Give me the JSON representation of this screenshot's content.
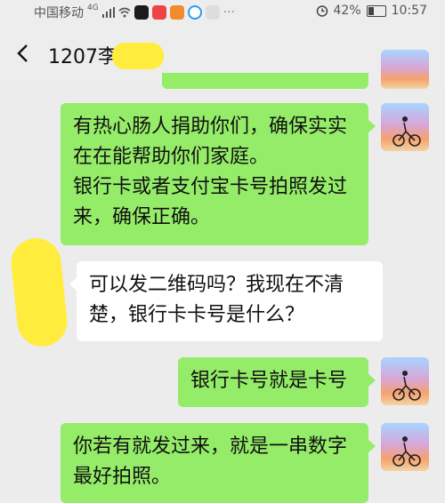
{
  "status_bar": {
    "carrier": "中国移动",
    "network": "4G",
    "battery_percent": "42%",
    "battery_level": 0.42,
    "time": "10:57"
  },
  "header": {
    "title": "1207李",
    "back_icon": "chevron-left-icon",
    "more_icon": "more-dots-icon"
  },
  "messages": [
    {
      "side": "right",
      "text_lines": [
        "有热心肠人捐助你们，确保实实",
        "在在能帮助你们家庭。",
        "银行卡或者支付宝卡号拍照发过",
        "来，确保正确。"
      ]
    },
    {
      "side": "left",
      "text_lines": [
        "可以发二维码吗？我现在不清",
        "楚，银行卡卡号是什么？"
      ]
    },
    {
      "side": "right",
      "text_lines": [
        "银行卡号就是卡号"
      ]
    },
    {
      "side": "right",
      "text_lines": [
        "你若有就发过来，就是一串数字",
        "最好拍照。"
      ]
    }
  ],
  "colors": {
    "self_bubble": "#95ec69",
    "peer_bubble": "#ffffff",
    "background": "#ececec",
    "redaction": "#ffec3d"
  }
}
